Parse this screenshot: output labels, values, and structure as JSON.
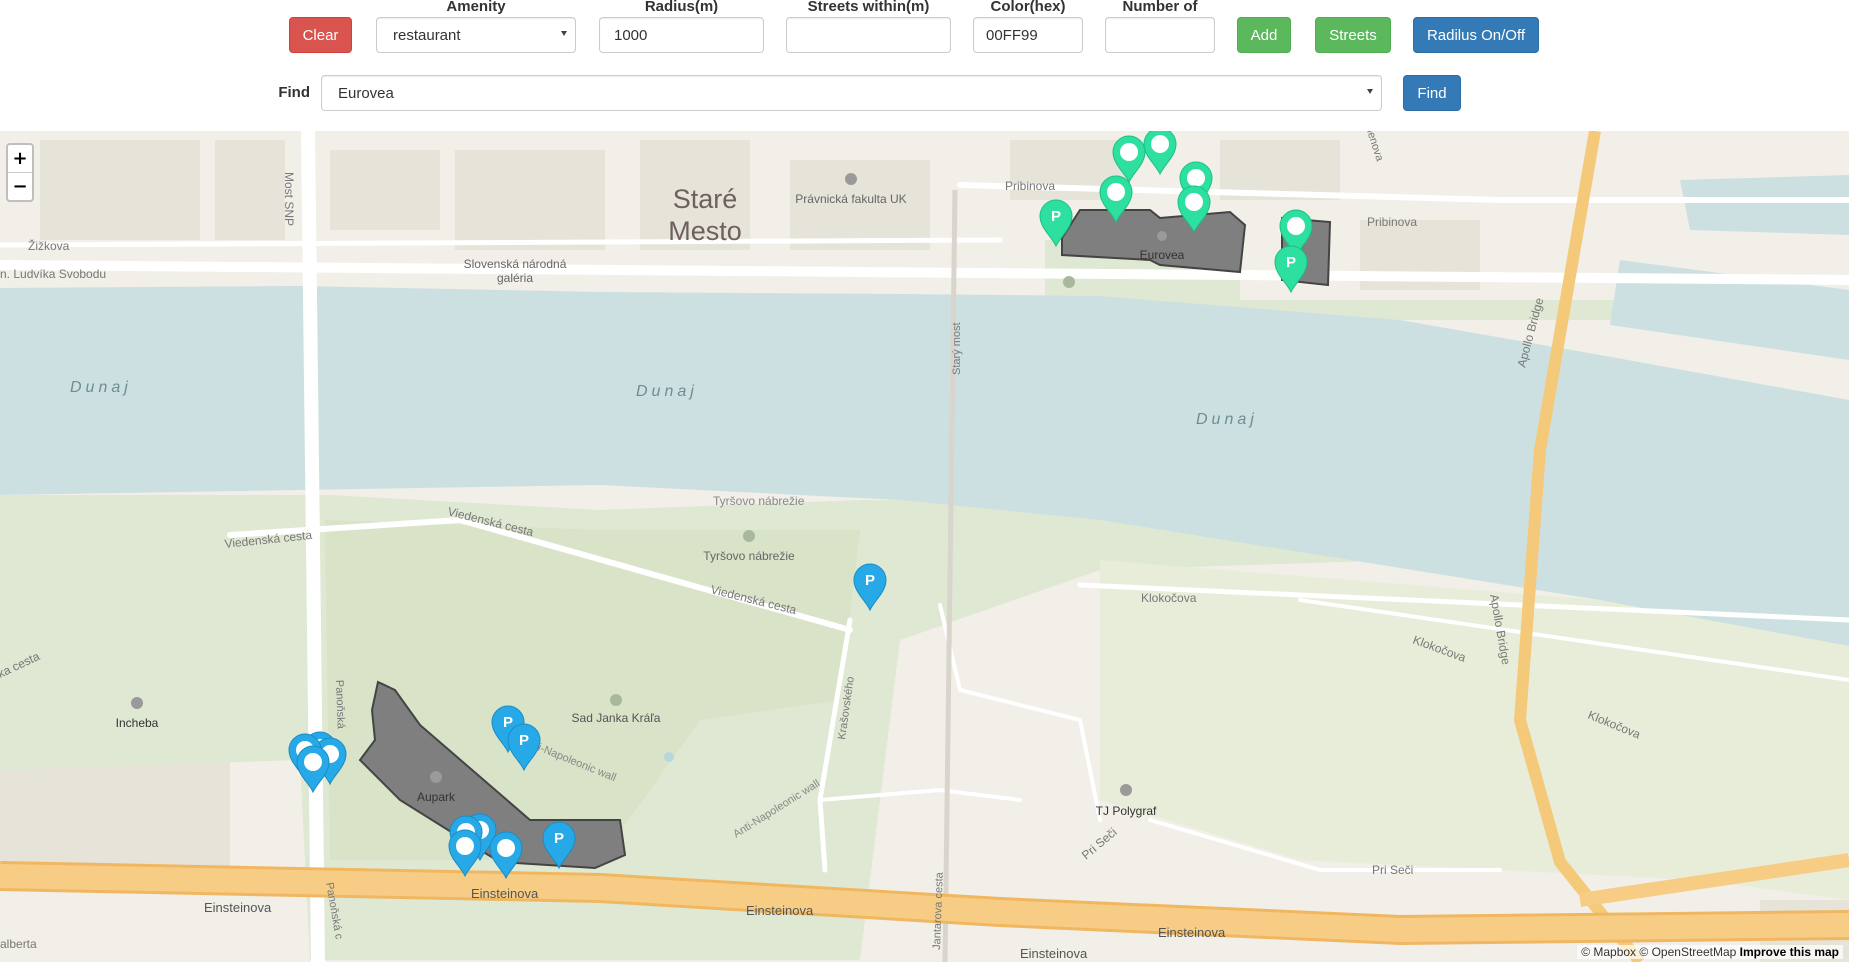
{
  "controls": {
    "clear_label": "Clear",
    "amenity_label": "Amenity",
    "amenity_value": "restaurant",
    "radius_label": "Radius(m)",
    "radius_value": "1000",
    "streets_within_label": "Streets within(m)",
    "streets_within_value": "",
    "color_label": "Color(hex)",
    "color_value": "00FF99",
    "number_of_label": "Number of",
    "number_of_value": "",
    "add_label": "Add",
    "streets_label": "Streets",
    "radius_toggle_label": "Radilus On/Off",
    "find_label": "Find",
    "find_value": "Eurovea",
    "find_button_label": "Find"
  },
  "map": {
    "zoom_in": "+",
    "zoom_out": "−",
    "attribution_mapbox": "© Mapbox",
    "attribution_osm": "© OpenStreetMap",
    "attribution_improve": "Improve this map",
    "labels": {
      "stare_mesto_1": "Staré",
      "stare_mesto_2": "Mesto",
      "pravnicka": "Právnická fakulta UK",
      "snd_1": "Slovenská národná",
      "snd_2": "galéria",
      "pribinova_1": "Pribinova",
      "pribinova_2": "Pribinova",
      "eurovea": "Eurovea",
      "zizkova": "Žižkova",
      "ludvika_svobodu": "n. Ludvíka Svobodu",
      "most_snp": "Most SNP",
      "dunaj_1": "Dunaj",
      "dunaj_2": "Dunaj",
      "dunaj_3": "Dunaj",
      "stary_most": "Starý most",
      "apollo_bridge_1": "Apollo Bridge",
      "apollo_bridge_2": "Apollo Bridge",
      "viedenska_1": "Viedenská cesta",
      "viedenska_2": "Viedenská cesta",
      "viedenska_3": "Viedenská cesta",
      "viedenska_4": "ka cesta",
      "tyrsovo_1": "Tyršovo nábrežie",
      "tyrsovo_2": "Tyršovo nábrežie",
      "klokocova_1": "Klokočova",
      "klokocova_2": "Klokočova",
      "klokocova_3": "Klokočova",
      "incheba": "Incheba",
      "sad_janka": "Sad Janka Kráľa",
      "aupark": "Aupark",
      "napoleonic_1": "Anti-Napoleonic wall",
      "napoleonic_2": "Anti-Napoleonic wall",
      "krasovskeho": "Krašovského",
      "jantarova": "Jantarova cesta",
      "tj_polygraf": "TJ Polygraf",
      "pri_seci_1": "Pri Seči",
      "pri_seci_2": "Pri Seči",
      "panonska_1": "Panoňská",
      "panonska_2": "Panoňská c",
      "einsteinova_1": "Einsteinova",
      "einsteinova_2": "Einsteinova",
      "einsteinova_3": "Einsteinova",
      "einsteinova_4": "Einsteinova",
      "einsteinova_5": "Einsteinova",
      "alberta": "alberta",
      "lenova": "lenova"
    },
    "parking_marker_text": "P",
    "colors": {
      "river": "#cce0e2",
      "park": "#dde6cf",
      "road_major": "#f4c97a",
      "highlight": "#7f7f7f",
      "marker_green": "#2ee0a0",
      "marker_blue": "#27a9e8"
    }
  }
}
